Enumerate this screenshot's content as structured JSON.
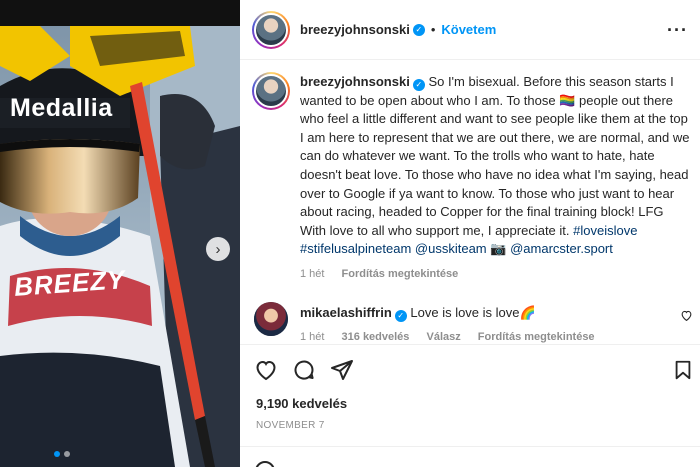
{
  "post": {
    "username": "breezyjohnsonski",
    "follow_label": "Követem",
    "more_label": "···",
    "caption_before_flag": "So I'm bisexual. Before this season starts I wanted to be open about who I am. To those ",
    "flag_emoji": "🏳️‍🌈",
    "caption_after_flag": " people out there who feel a little different and want to see people like them at the top I am here to represent that we are out there, we are normal, and we can do whatever we want. To the trolls who want to hate, hate doesn't beat love. To those who have no idea what I'm saying, head over to Google if ya want to know. To those who just want to hear about racing, headed to Copper for the final training block! LFG With love to all who support me, I appreciate it. ",
    "hashtags": [
      "#loveislove",
      "#stifelusalpineteam",
      "@usskiteam"
    ],
    "camera_emoji": "📷",
    "photo_credit": "@amarcster.sport",
    "caption_time": "1 hét",
    "caption_translate": "Fordítás megtekintése",
    "likes": "9,190 kedvelés",
    "date": "NOVEMBER 7"
  },
  "photo": {
    "helmet_text": "Medallia",
    "suit_text": "BREEZY"
  },
  "comment": {
    "username": "mikaelashiffrin",
    "text": "Love is love is love",
    "emoji": "🌈",
    "time": "1 hét",
    "likes": "316 kedvelés",
    "reply": "Válasz",
    "translate": "Fordítás megtekintése"
  },
  "colors": {
    "accent": "#0095f6",
    "text": "#262626",
    "muted": "#8e8e8e",
    "link": "#00376b"
  }
}
